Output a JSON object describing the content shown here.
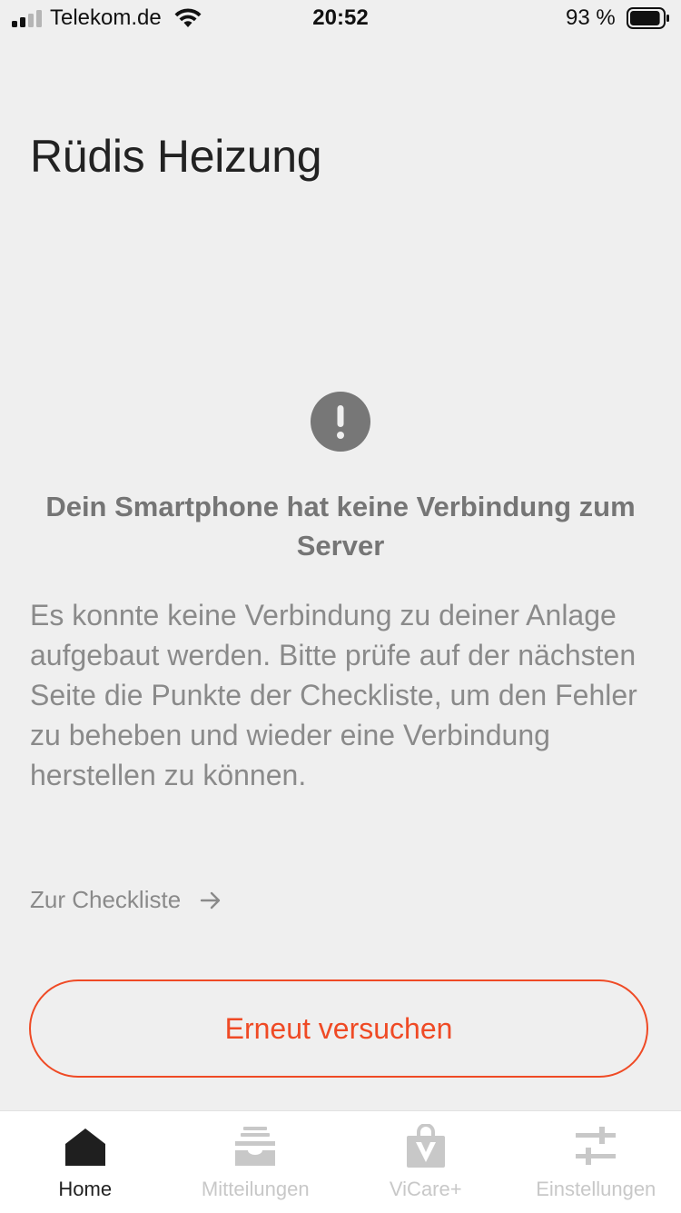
{
  "status_bar": {
    "carrier": "Telekom.de",
    "time": "20:52",
    "battery_percent": "93 %",
    "battery_level": 0.93
  },
  "page": {
    "title": "Rüdis Heizung"
  },
  "error": {
    "icon": "exclamation-icon",
    "heading": "Dein Smartphone hat keine Verbindung zum Server",
    "body": "Es konnte keine Verbindung zu deiner Anlage aufgebaut werden. Bitte prüfe auf der nächsten Seite die Punkte der Checkliste, um den Fehler zu beheben und wieder eine Verbindung herstellen zu können.",
    "checklist_link": "Zur Checkliste",
    "retry_button": "Erneut versuchen"
  },
  "tabs": [
    {
      "label": "Home",
      "icon": "home-icon",
      "active": true
    },
    {
      "label": "Mitteilungen",
      "icon": "inbox-icon",
      "active": false
    },
    {
      "label": "ViCare+",
      "icon": "shopping-bag-icon",
      "active": false
    },
    {
      "label": "Einstellungen",
      "icon": "sliders-icon",
      "active": false
    }
  ],
  "colors": {
    "accent": "#ef4a25",
    "background": "#efefef",
    "muted_text": "#8a8a8a",
    "inactive_tab": "#c8c8c8"
  }
}
